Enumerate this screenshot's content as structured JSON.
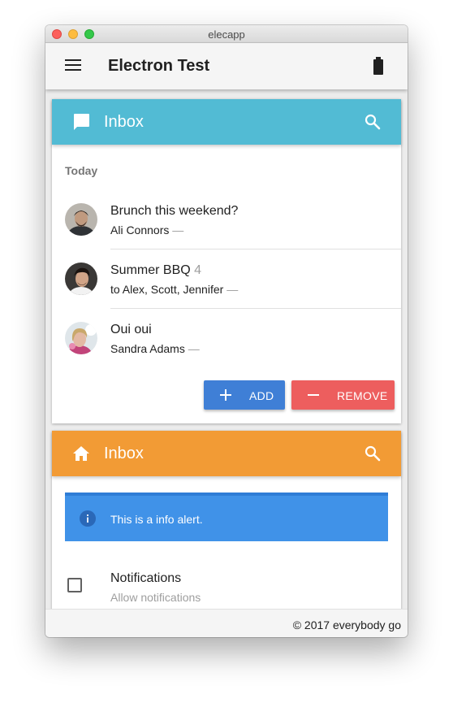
{
  "window": {
    "title": "elecapp"
  },
  "appbar": {
    "title": "Electron Test",
    "menu_icon": "menu-icon",
    "status_icon": "battery-full-icon"
  },
  "card1": {
    "header": {
      "title": "Inbox",
      "icon": "chat-bubble-icon",
      "action_icon": "search-icon",
      "color": "#52bbd4"
    },
    "subheader": "Today",
    "items": [
      {
        "subject": "Brunch this weekend?",
        "count": "",
        "from": "Ali Connors",
        "dash": "—"
      },
      {
        "subject": "Summer BBQ",
        "count": "4",
        "from": "to Alex, Scott, Jennifer",
        "dash": "—"
      },
      {
        "subject": "Oui oui",
        "count": "",
        "from": "Sandra Adams",
        "dash": "—"
      }
    ],
    "add_button": {
      "label": "ADD",
      "icon": "plus-icon",
      "color": "#3f7fd6"
    },
    "remove_button": {
      "label": "REMOVE",
      "icon": "minus-icon",
      "color": "#ed5e5e"
    }
  },
  "card2": {
    "header": {
      "title": "Inbox",
      "icon": "home-icon",
      "action_icon": "search-icon",
      "color": "#f29b35"
    },
    "alert": {
      "text": "This is a info alert.",
      "icon": "info-icon",
      "color": "#4092e8"
    },
    "notification": {
      "title": "Notifications",
      "subtitle": "Allow notifications",
      "checked": false
    }
  },
  "footer": {
    "text": "© 2017 everybody go"
  }
}
